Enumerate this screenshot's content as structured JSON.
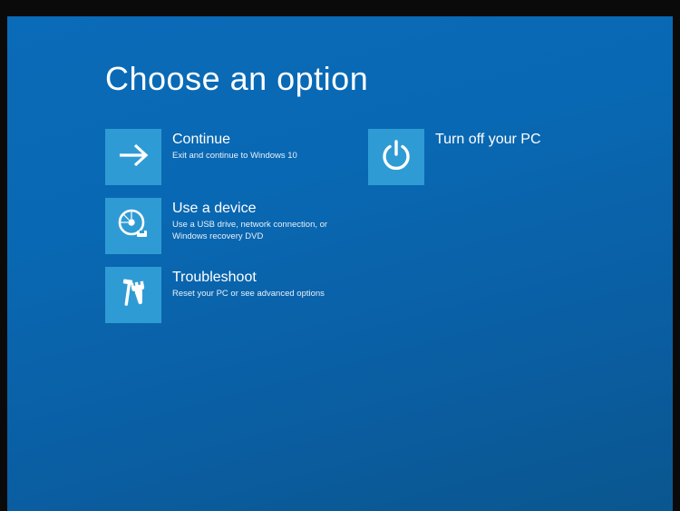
{
  "title": "Choose an option",
  "options": {
    "continue": {
      "title": "Continue",
      "desc": "Exit and continue to Windows 10"
    },
    "turnoff": {
      "title": "Turn off your PC",
      "desc": ""
    },
    "device": {
      "title": "Use a device",
      "desc": "Use a USB drive, network connection, or Windows recovery DVD"
    },
    "troubleshoot": {
      "title": "Troubleshoot",
      "desc": "Reset your PC or see advanced options"
    }
  }
}
